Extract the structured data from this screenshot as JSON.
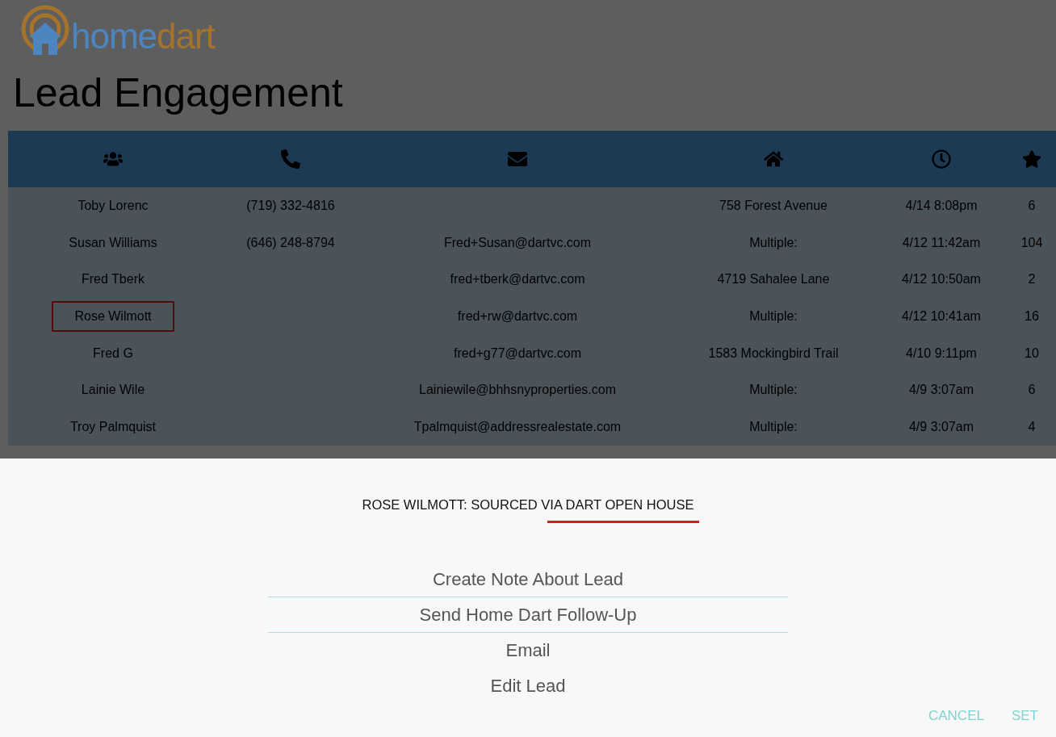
{
  "logo": [
    {
      "text": "home",
      "color": "#4d85c0"
    },
    {
      "text": "dart",
      "color": "#a5742c"
    }
  ],
  "title": "Lead Engagement",
  "table": {
    "columns": [
      {
        "kind": "people"
      },
      {
        "kind": "phone"
      },
      {
        "kind": "email"
      },
      {
        "kind": "home"
      },
      {
        "kind": "clock"
      },
      {
        "kind": "star"
      }
    ],
    "rows": [
      {
        "cells": [
          "Toby Lorenc",
          "(719) 332-4816",
          "",
          "758 Forest Avenue",
          "4/14 8:08pm",
          "6"
        ],
        "highlighted": false
      },
      {
        "cells": [
          "Susan Williams",
          "(646) 248-8794",
          "Fred+Susan@dartvc.com",
          "Multiple:",
          "4/12 11:42am",
          "104"
        ],
        "highlighted": false
      },
      {
        "cells": [
          "Fred Tberk",
          "",
          "fred+tberk@dartvc.com",
          "4719 Sahalee Lane",
          "4/12 10:50am",
          "2"
        ],
        "highlighted": false
      },
      {
        "cells": [
          "Rose Wilmott",
          "",
          "fred+rw@dartvc.com",
          "Multiple:",
          "4/12 10:41am",
          "16"
        ],
        "highlighted": true
      },
      {
        "cells": [
          "Fred G",
          "",
          "fred+g77@dartvc.com",
          "1583 Mockingbird Trail",
          "4/10 9:11pm",
          "10"
        ],
        "highlighted": false
      },
      {
        "cells": [
          "Lainie Wile",
          "",
          "Lainiewile@bhhsnyproperties.com",
          "Multiple:",
          "4/9 3:07am",
          "6"
        ],
        "highlighted": false
      },
      {
        "cells": [
          "Troy Palmquist",
          "",
          "Tpalmquist@addressrealestate.com",
          "Multiple:",
          "4/9 3:07am",
          "4"
        ],
        "highlighted": false
      }
    ]
  },
  "dialog": {
    "heading": "ROSE WILMOTT: SOURCED VIA DART OPEN HOUSE",
    "underlined": true,
    "actions": [
      "Create Note About Lead",
      "Send Home Dart Follow-Up",
      "Email",
      "Edit Lead"
    ],
    "buttons": [
      "CANCEL",
      "SET"
    ]
  }
}
